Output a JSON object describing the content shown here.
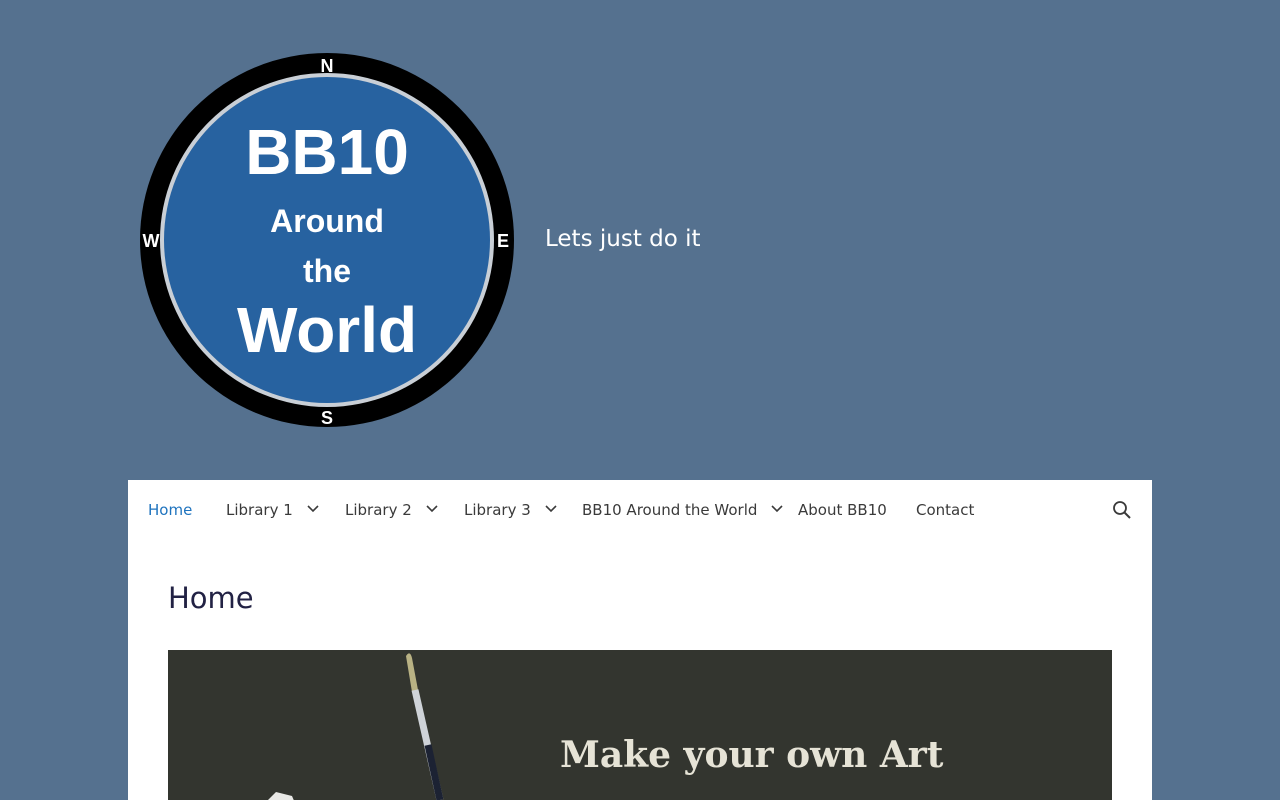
{
  "header": {
    "logo_text": [
      "BB10",
      "Around",
      "the",
      "World"
    ],
    "compass": {
      "n": "N",
      "e": "E",
      "s": "S",
      "w": "W"
    },
    "tagline": "Lets just do it"
  },
  "nav": {
    "items": [
      {
        "label": "Home",
        "active": true,
        "has_dropdown": false
      },
      {
        "label": "Library 1",
        "active": false,
        "has_dropdown": true
      },
      {
        "label": "Library 2",
        "active": false,
        "has_dropdown": true
      },
      {
        "label": "Library 3",
        "active": false,
        "has_dropdown": true
      },
      {
        "label": "BB10 Around the World",
        "active": false,
        "has_dropdown": true
      },
      {
        "label": "About BB10",
        "active": false,
        "has_dropdown": false
      },
      {
        "label": "Contact",
        "active": false,
        "has_dropdown": false
      }
    ],
    "search_icon": "search-icon"
  },
  "main": {
    "page_title": "Home",
    "hero_text": "Make your own Art"
  },
  "colors": {
    "page_bg": "#55718F",
    "logo_blue": "#2762A0",
    "link_active": "#1e73be",
    "nav_text": "#3a3a3a",
    "title_text": "#222244",
    "hero_bg": "#33352f"
  }
}
